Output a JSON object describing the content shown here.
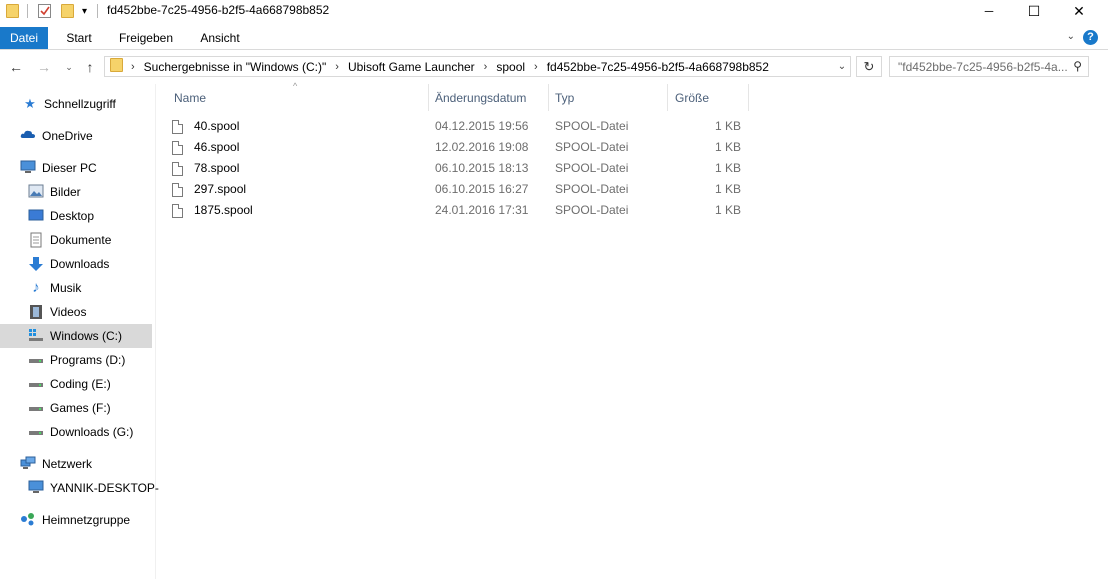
{
  "window": {
    "title": "fd452bbe-7c25-4956-b2f5-4a668798b852",
    "minimize_glyph": "─",
    "maximize_glyph": "☐",
    "close_glyph": "✕"
  },
  "ribbon": {
    "tabs": [
      "Datei",
      "Start",
      "Freigeben",
      "Ansicht"
    ],
    "help_glyph": "?",
    "collapse_glyph": "⌄"
  },
  "address": {
    "crumbs": [
      "Suchergebnisse in \"Windows (C:)\"",
      "Ubisoft Game Launcher",
      "spool",
      "fd452bbe-7c25-4956-b2f5-4a668798b852"
    ],
    "search_text": "\"fd452bbe-7c25-4956-b2f5-4a..."
  },
  "nav": {
    "items": [
      {
        "label": "Schnellzugriff",
        "icon": "star-icon"
      },
      {
        "label": "OneDrive",
        "icon": "cloud-icon"
      },
      {
        "label": "Dieser PC",
        "icon": "computer-icon"
      },
      {
        "label": "Bilder",
        "icon": "pictures-icon"
      },
      {
        "label": "Desktop",
        "icon": "desktop-icon"
      },
      {
        "label": "Dokumente",
        "icon": "documents-icon"
      },
      {
        "label": "Downloads",
        "icon": "download-arrow-icon"
      },
      {
        "label": "Musik",
        "icon": "music-note-icon"
      },
      {
        "label": "Videos",
        "icon": "film-icon"
      },
      {
        "label": "Windows (C:)",
        "icon": "windows-drive-icon"
      },
      {
        "label": "Programs (D:)",
        "icon": "drive-icon"
      },
      {
        "label": "Coding (E:)",
        "icon": "drive-icon"
      },
      {
        "label": "Games (F:)",
        "icon": "drive-icon"
      },
      {
        "label": "Downloads (G:)",
        "icon": "drive-icon"
      },
      {
        "label": "Netzwerk",
        "icon": "network-icon"
      },
      {
        "label": "YANNIK-DESKTOP-",
        "icon": "computer-icon"
      },
      {
        "label": "Heimnetzgruppe",
        "icon": "homegroup-icon"
      }
    ]
  },
  "columns": [
    "Name",
    "Änderungsdatum",
    "Typ",
    "Größe"
  ],
  "files": [
    {
      "name": "40.spool",
      "date": "04.12.2015 19:56",
      "type": "SPOOL-Datei",
      "size": "1 KB"
    },
    {
      "name": "46.spool",
      "date": "12.02.2016 19:08",
      "type": "SPOOL-Datei",
      "size": "1 KB"
    },
    {
      "name": "78.spool",
      "date": "06.10.2015 18:13",
      "type": "SPOOL-Datei",
      "size": "1 KB"
    },
    {
      "name": "297.spool",
      "date": "06.10.2015 16:27",
      "type": "SPOOL-Datei",
      "size": "1 KB"
    },
    {
      "name": "1875.spool",
      "date": "24.01.2016 17:31",
      "type": "SPOOL-Datei",
      "size": "1 KB"
    }
  ],
  "colors": {
    "accent": "#1979ca",
    "header_text": "#4c607a",
    "selected": "#d9d9d9"
  }
}
